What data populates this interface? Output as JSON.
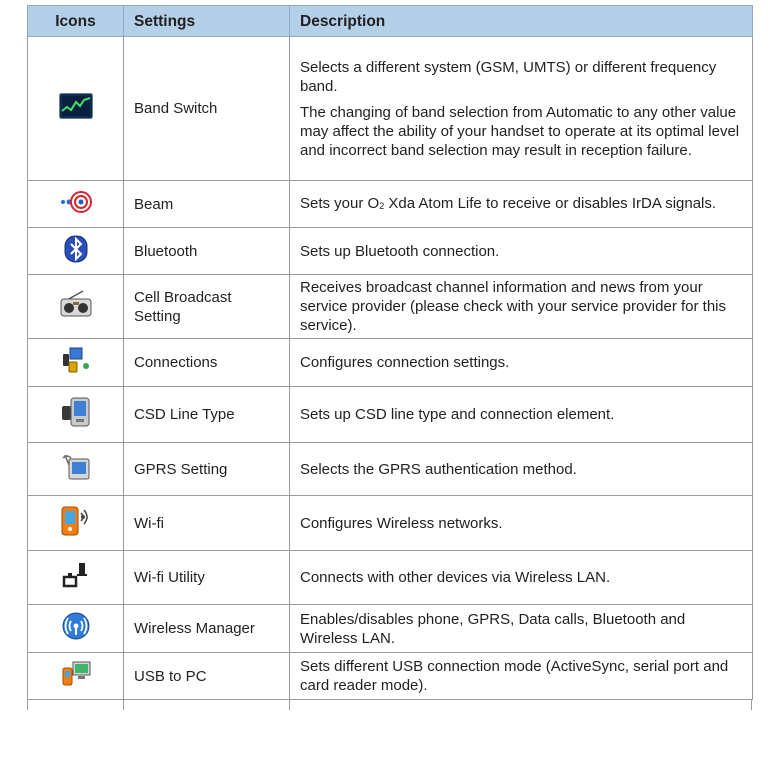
{
  "headers": {
    "icons": "Icons",
    "settings": "Settings",
    "description": "Description"
  },
  "rows": [
    {
      "icon": "band-switch-icon",
      "setting": "Band Switch",
      "description": [
        "Selects a different system (GSM, UMTS) or different frequency band.",
        "The changing of band selection from Automatic to any other value may affect the ability of your handset to operate at its optimal level and incorrect band selection may result in reception failure."
      ]
    },
    {
      "icon": "beam-icon",
      "setting": "Beam",
      "description_pre": "Sets your O",
      "description_sub": "2",
      "description_post": " Xda Atom Life to receive or disables IrDA signals."
    },
    {
      "icon": "bluetooth-icon",
      "setting": "Bluetooth",
      "description": [
        "Sets up Bluetooth connection."
      ]
    },
    {
      "icon": "radio-icon",
      "setting": "Cell Broadcast Setting",
      "description": [
        "Receives broadcast channel information and news from your service provider (please check with your service provider for this service)."
      ]
    },
    {
      "icon": "connections-icon",
      "setting": "Connections",
      "description": [
        "Configures connection settings."
      ]
    },
    {
      "icon": "pda-icon",
      "setting": "CSD Line Type",
      "description": [
        "Sets up CSD line type and connection element."
      ]
    },
    {
      "icon": "gprs-icon",
      "setting": "GPRS Setting",
      "description": [
        "Selects the GPRS authentication method."
      ]
    },
    {
      "icon": "wifi-icon",
      "setting": "Wi-fi",
      "description": [
        "Configures Wireless networks."
      ]
    },
    {
      "icon": "network-plug-icon",
      "setting": "Wi-fi Utility",
      "description": [
        "Connects with other devices via Wireless LAN."
      ]
    },
    {
      "icon": "wireless-manager-icon",
      "setting": "Wireless Manager",
      "description": [
        "Enables/disables phone, GPRS, Data calls, Bluetooth and Wireless LAN."
      ]
    },
    {
      "icon": "usb-pc-icon",
      "setting": "USB to PC",
      "description": [
        "Sets different USB connection mode (ActiveSync, serial port and card reader mode)."
      ]
    }
  ]
}
